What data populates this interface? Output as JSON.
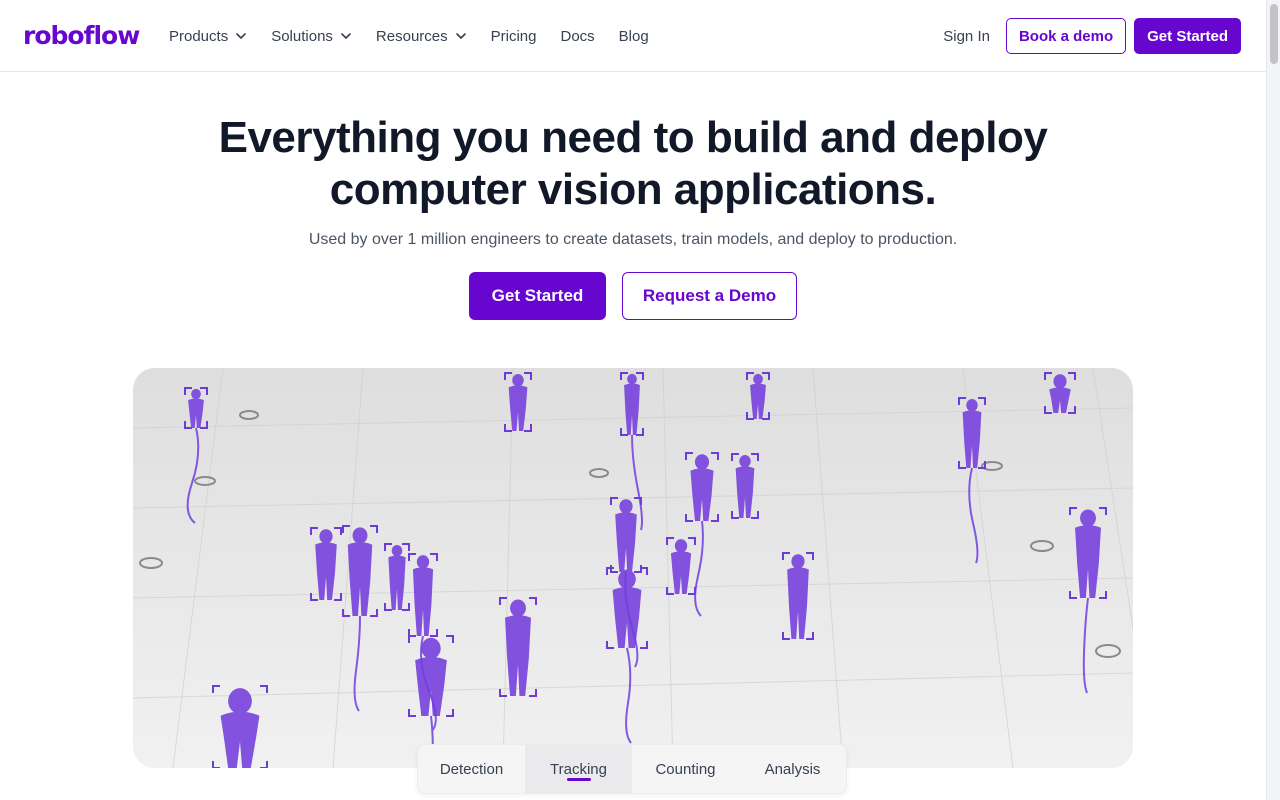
{
  "brand": {
    "name": "roboflow",
    "color": "#6706ce"
  },
  "nav": {
    "items": [
      {
        "label": "Products",
        "dropdown": true
      },
      {
        "label": "Solutions",
        "dropdown": true
      },
      {
        "label": "Resources",
        "dropdown": true
      },
      {
        "label": "Pricing",
        "dropdown": false
      },
      {
        "label": "Docs",
        "dropdown": false
      },
      {
        "label": "Blog",
        "dropdown": false
      }
    ],
    "sign_in": "Sign In",
    "book_demo": "Book a demo",
    "get_started": "Get Started"
  },
  "hero": {
    "title_line1": "Everything you need to build and deploy",
    "title_line2": "computer vision applications.",
    "subtitle": "Used by over 1 million engineers to create datasets, train models, and deploy to production.",
    "primary_cta": "Get Started",
    "secondary_cta": "Request a Demo"
  },
  "demo": {
    "tabs": [
      {
        "label": "Detection",
        "active": false
      },
      {
        "label": "Tracking",
        "active": true
      },
      {
        "label": "Counting",
        "active": false
      },
      {
        "label": "Analysis",
        "active": false
      }
    ],
    "highlight_color": "#7c4dff"
  }
}
